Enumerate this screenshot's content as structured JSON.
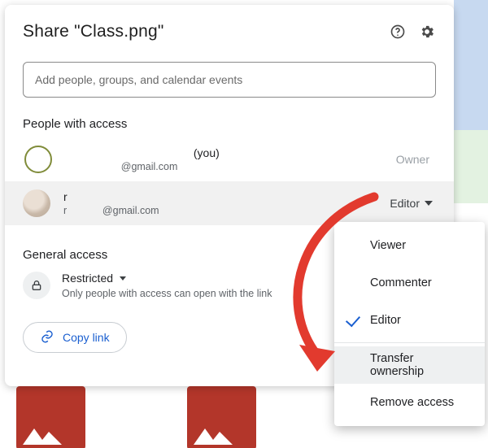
{
  "dialog": {
    "title": "Share \"Class.png\"",
    "search_placeholder": "Add people, groups, and calendar events"
  },
  "sections": {
    "people_heading": "People with access",
    "general_heading": "General access"
  },
  "people": {
    "owner": {
      "name_suffix": "(you)",
      "email": "@gmail.com",
      "role": "Owner"
    },
    "editor": {
      "name": "r",
      "email_prefix": "r",
      "email_domain": "@gmail.com",
      "role": "Editor"
    }
  },
  "general_access": {
    "mode": "Restricted",
    "description": "Only people with access can open with the link"
  },
  "copy_link_label": "Copy link",
  "menu": {
    "viewer": "Viewer",
    "commenter": "Commenter",
    "editor": "Editor",
    "transfer": "Transfer ownership",
    "remove": "Remove access"
  },
  "colors": {
    "link_blue": "#1a5fd0",
    "arrow_red": "#e23a2e"
  }
}
